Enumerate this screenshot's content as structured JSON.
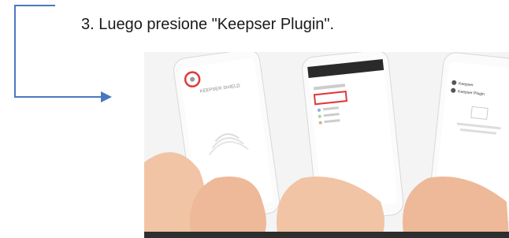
{
  "instruction": {
    "text": "3. Luego presione \"Keepser Plugin\"."
  },
  "phones": {
    "phone1_logo": "KEEPSER SHIELD",
    "phone3_entries": [
      "Keepser",
      "Keepser Plugin"
    ]
  },
  "colors": {
    "arrow": "#4a78c0",
    "highlight": "#e03a3a",
    "skin": "#f0c4a4",
    "phone_body": "#f7f7f7"
  }
}
